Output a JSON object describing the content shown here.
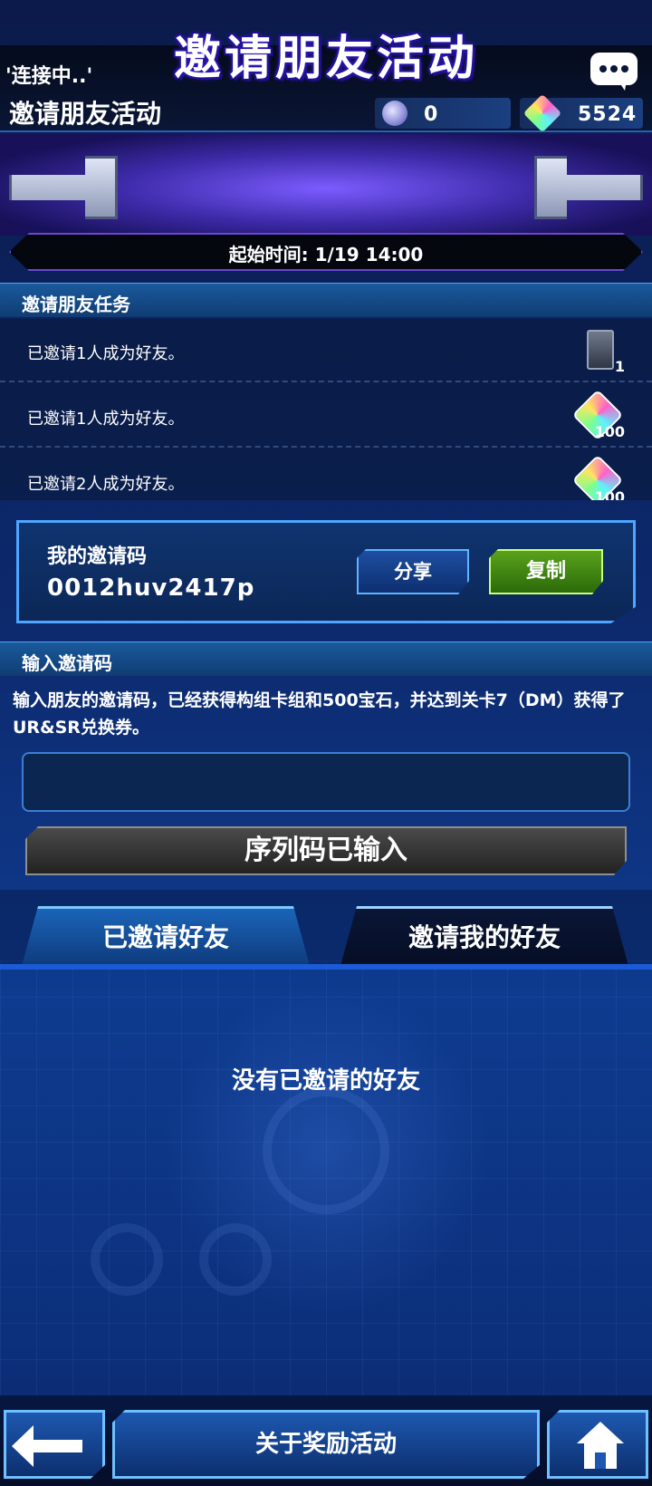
{
  "status": {
    "connection_text": "'连接中..'",
    "page_title": "邀请朋友活动",
    "orbs": "0",
    "gems": "5524"
  },
  "banner": {
    "title": "邀请朋友活动",
    "start_time": "起始时间: 1/19 14:00"
  },
  "tasks": {
    "header": "邀请朋友任务",
    "items": [
      {
        "text": "已邀请1人成为好友。",
        "reward_icon": "card-pack-icon",
        "reward_count": "1"
      },
      {
        "text": "已邀请1人成为好友。",
        "reward_icon": "gem-icon",
        "reward_count": "100"
      },
      {
        "text": "已邀请2人成为好友。",
        "reward_icon": "gem-icon",
        "reward_count": "100"
      }
    ]
  },
  "my_code": {
    "label": "我的邀请码",
    "code": "0012huv2417p",
    "share_label": "分享",
    "copy_label": "复制"
  },
  "enter_code": {
    "header": "输入邀请码",
    "description": "输入朋友的邀请码，已经获得构组卡组和500宝石，并达到关卡7（DM）获得了UR&SR兑换券。",
    "input_value": "",
    "button_label": "序列码已输入"
  },
  "tabs": {
    "invited": "已邀请好友",
    "inviters": "邀请我的好友"
  },
  "empty_message": "没有已邀请的好友",
  "bottom": {
    "about_label": "关于奖励活动"
  },
  "colors": {
    "accent_blue": "#4da6ff",
    "copy_green": "#5aa21c",
    "banner_purple": "#3d2aa8"
  }
}
